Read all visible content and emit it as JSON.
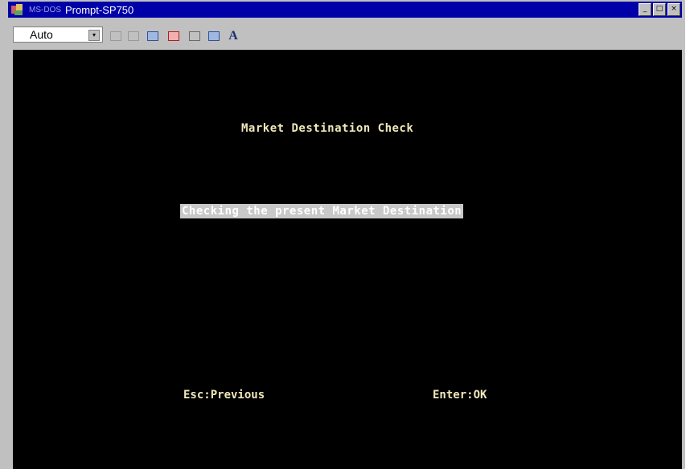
{
  "window": {
    "title_prefix": "MS-DOS",
    "title": "Prompt-SP750",
    "controls": {
      "minimize": "_",
      "maximize": "□",
      "close": "×"
    }
  },
  "toolbar": {
    "font_size_value": "Auto",
    "dropdown_arrow": "▾",
    "font_button_label": "A"
  },
  "screen": {
    "heading": "Market Destination Check",
    "status": "Checking the present Market Destination",
    "esc_label": "Esc:Previous",
    "enter_label": "Enter:OK"
  }
}
